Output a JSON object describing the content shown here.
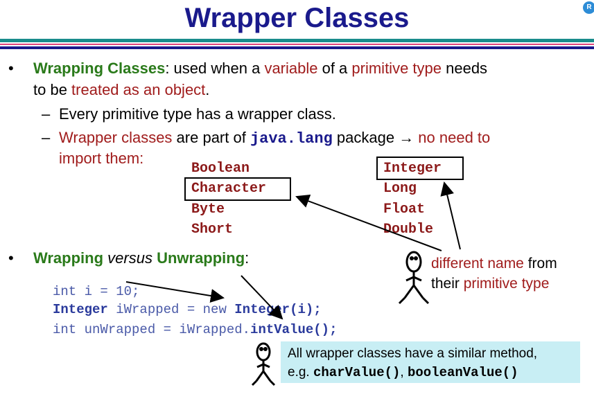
{
  "title": "Wrapper Classes",
  "corner_badge": "R",
  "bullet1": {
    "term": "Wrapping Classes",
    "t1": ": used when a ",
    "t2": "variable",
    "t3": " of a ",
    "t4": "primitive type",
    "t5": " needs",
    "t6": "to be ",
    "t7": "treated as an object",
    "t8": "."
  },
  "sub1": {
    "dash": "–",
    "text": "Every primitive type has a wrapper class."
  },
  "sub2": {
    "dash": "–",
    "t1": "Wrapper classes",
    "t2": " are part of ",
    "pkg": "java.lang",
    "t3": " package ",
    "arrow": "→",
    "t4": " no need to",
    "t5": "import them:"
  },
  "wrapper_classes": {
    "left": [
      "Boolean",
      "Character",
      "Byte",
      "Short"
    ],
    "right": [
      "Integer",
      "Long",
      "Float",
      "Double"
    ]
  },
  "bullet2": {
    "t1": "Wrapping",
    "t2": " versus ",
    "t3": "Unwrapping",
    "t4": ":"
  },
  "code": {
    "line1": "int i = 10;",
    "line2_kw": "Integer",
    "line2_mid": " iWrapped = new ",
    "line2_call": "Integer(i);",
    "line3_a": "int unWrapped = iWrapped.",
    "line3_call": "intValue();"
  },
  "callout1": {
    "t1": "different name",
    "t2": " from",
    "t3": "their ",
    "t4": "primitive type"
  },
  "callout2": {
    "line1": "All wrapper classes have a similar method,",
    "line2_a": "e.g. ",
    "m1": "charValue()",
    "sep": ", ",
    "m2": "booleanValue()"
  },
  "colors": {
    "title": "#1a1a8c",
    "green": "#2a7a1a",
    "red": "#a01c1c",
    "note_bg": "#c8eef4"
  }
}
